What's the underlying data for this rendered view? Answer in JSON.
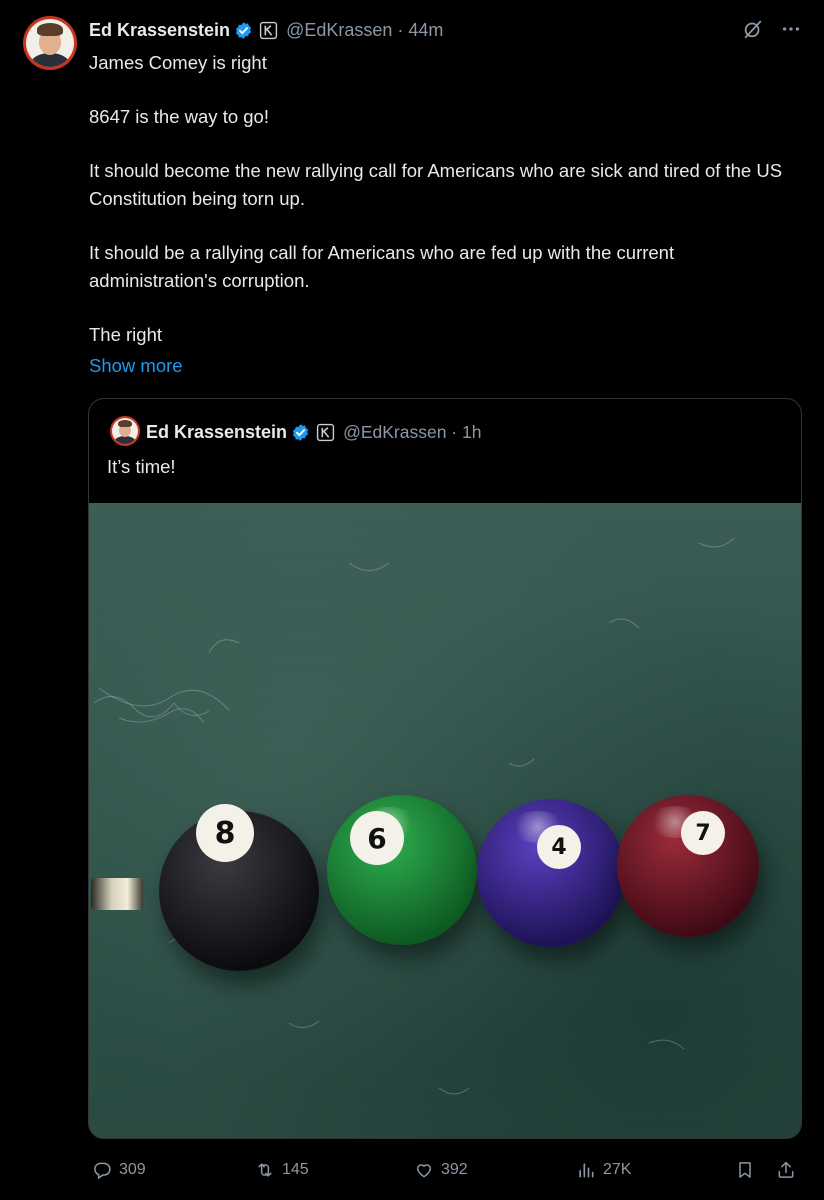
{
  "tweet": {
    "author_name": "Ed Krassenstein",
    "handle_time": "@EdKrassen · 44m",
    "paragraphs": [
      "James Comey is right",
      "8647 is the way to go!",
      "It should become the new rallying call for Americans who are sick and tired of the US Constitution being torn up.",
      "It should be a rallying call for Americans who are fed up with the current administration's corruption.",
      "The right"
    ],
    "show_more": "Show more"
  },
  "quoted_tweet": {
    "author_name": "Ed Krassenstein",
    "handle_time": "@EdKrassen · 1h",
    "text": "It’s time!",
    "media_balls": [
      "8",
      "6",
      "4",
      "7"
    ]
  },
  "actions": {
    "replies": "309",
    "reposts": "145",
    "likes": "392",
    "views": "27K"
  },
  "icons": {
    "verified": "verified-badge-icon",
    "affiliate": "affiliate-k-icon",
    "grok": "grok-icon",
    "more": "more-icon",
    "reply": "reply-icon",
    "repost": "repost-icon",
    "like": "heart-icon",
    "views": "views-icon",
    "bookmark": "bookmark-icon",
    "share": "share-icon"
  },
  "colors": {
    "background": "#000000",
    "text": "#e7e9ea",
    "secondary": "#8b98a5",
    "link": "#1d9bf0",
    "verified": "#1d9bf0"
  }
}
